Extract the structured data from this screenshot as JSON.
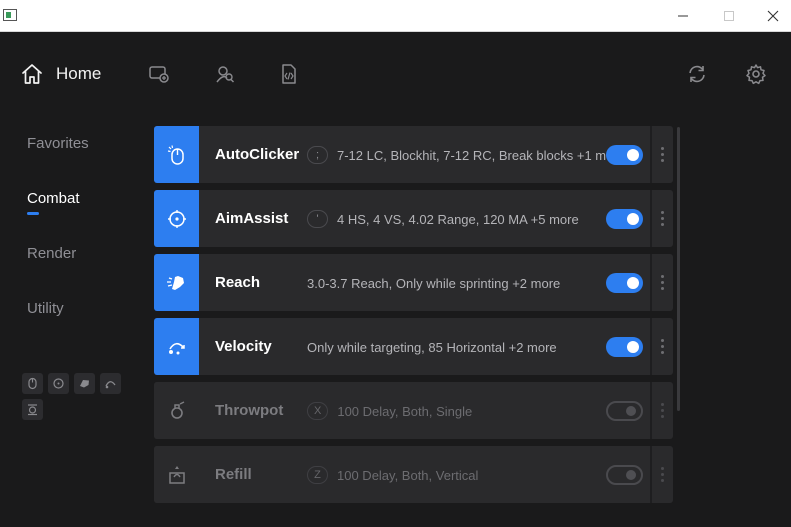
{
  "window": {
    "minimize_icon": "minimize-icon",
    "maximize_icon": "maximize-icon",
    "close_icon": "close-icon"
  },
  "header": {
    "home_label": "Home",
    "icons": [
      "config-add-icon",
      "friends-icon",
      "script-icon",
      "refresh-icon",
      "gear-icon"
    ]
  },
  "sidebar": {
    "categories": [
      {
        "label": "Favorites",
        "active": false
      },
      {
        "label": "Combat",
        "active": true
      },
      {
        "label": "Render",
        "active": false
      },
      {
        "label": "Utility",
        "active": false
      }
    ],
    "mini_icons": [
      "mouse-icon",
      "crosshair-icon",
      "hand-icon",
      "velocity-icon",
      "refill-icon"
    ]
  },
  "modules": [
    {
      "name": "AutoClicker",
      "key": ";",
      "description": "7-12 LC, Blockhit, 7-12 RC, Break blocks +1 more",
      "enabled": true,
      "icon": "mouse-icon"
    },
    {
      "name": "AimAssist",
      "key": "'",
      "description": "4 HS, 4 VS, 4.02 Range, 120 MA +5 more",
      "enabled": true,
      "icon": "crosshair-icon"
    },
    {
      "name": "Reach",
      "key": "",
      "description": "3.0-3.7 Reach, Only while sprinting +2 more",
      "enabled": true,
      "icon": "hand-icon"
    },
    {
      "name": "Velocity",
      "key": "",
      "description": "Only while targeting, 85 Horizontal +2 more",
      "enabled": true,
      "icon": "velocity-icon"
    },
    {
      "name": "Throwpot",
      "key": "X",
      "description": "100 Delay, Both, Single",
      "enabled": false,
      "icon": "potion-icon"
    },
    {
      "name": "Refill",
      "key": "Z",
      "description": "100 Delay, Both, Vertical",
      "enabled": false,
      "icon": "refill-icon"
    }
  ],
  "colors": {
    "accent": "#2d7ef0",
    "background": "#1a1a1b",
    "row": "#2a2a2c"
  }
}
